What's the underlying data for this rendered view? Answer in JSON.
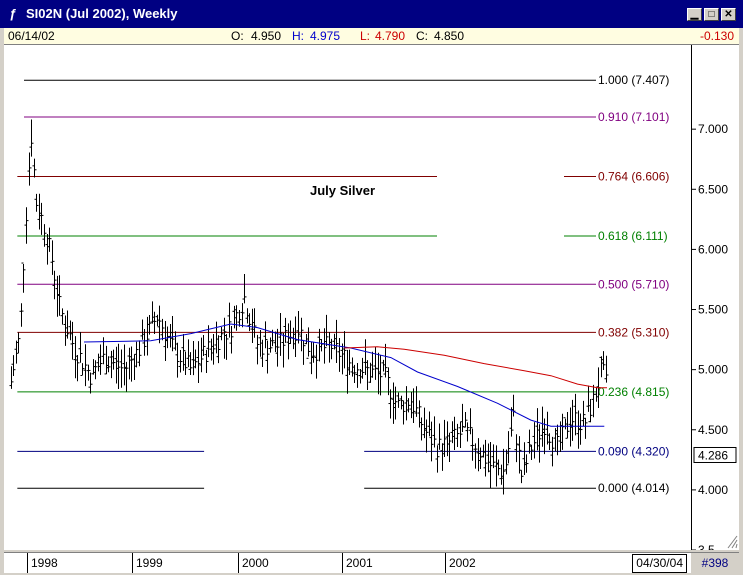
{
  "window": {
    "icon": "chart-icon",
    "title": "SI02N (Jul 2002), Weekly",
    "buttons": [
      "minimize",
      "maximize",
      "close"
    ]
  },
  "info": {
    "date": "06/14/02",
    "open_label": "O:",
    "open": "4.950",
    "high_label": "H:",
    "high": "4.975",
    "low_label": "L:",
    "low": "4.790",
    "close_label": "C:",
    "close": "4.850",
    "change": "-0.130"
  },
  "status": {
    "years": [
      "1998",
      "1999",
      "2000",
      "2001",
      "2002"
    ],
    "date_box": "04/30/04",
    "count": "#398"
  },
  "colors": {
    "background": "#ffffff",
    "price_bars": "#000000",
    "ma_short": "#0000cc",
    "ma_long": "#cc0000",
    "fib_black": "#000000",
    "fib_purple": "#800080",
    "fib_maroon": "#800000",
    "fib_green": "#008000",
    "fib_navy": "#000080"
  },
  "chart_data": {
    "type": "ohlc",
    "title": "July Silver",
    "ylim": [
      3.5,
      7.7
    ],
    "y_ticks": [
      "7.000",
      "6.500",
      "6.000",
      "5.500",
      "5.000",
      "4.500",
      "4.000",
      "3.5"
    ],
    "y_tick_values": [
      7.0,
      6.5,
      6.0,
      5.5,
      5.0,
      4.5,
      4.0,
      3.5
    ],
    "current_price_label": "4.286",
    "current_price": 4.286,
    "x_labels": [
      "1998",
      "1999",
      "2000",
      "2001",
      "2002"
    ],
    "x_range": [
      1997.9,
      2003.05
    ],
    "fib_levels": [
      {
        "ratio": "1.000",
        "price": "7.407",
        "value": 7.407,
        "color": "#000000",
        "label": "1.000 (7.407)"
      },
      {
        "ratio": "0.910",
        "price": "7.101",
        "value": 7.101,
        "color": "#800080",
        "label": "0.910 (7.101)"
      },
      {
        "ratio": "0.764",
        "price": "6.606",
        "value": 6.606,
        "color": "#800000",
        "label": "0.764 (6.606)"
      },
      {
        "ratio": "0.618",
        "price": "6.111",
        "value": 6.111,
        "color": "#008000",
        "label": "0.618 (6.111)"
      },
      {
        "ratio": "0.500",
        "price": "5.710",
        "value": 5.71,
        "color": "#800080",
        "label": "0.500 (5.710)"
      },
      {
        "ratio": "0.382",
        "price": "5.310",
        "value": 5.31,
        "color": "#800000",
        "label": "0.382 (5.310)"
      },
      {
        "ratio": "0.236",
        "price": "4.815",
        "value": 4.815,
        "color": "#008000",
        "label": "0.236 (4.815)"
      },
      {
        "ratio": "0.090",
        "price": "4.320",
        "value": 4.32,
        "color": "#000080",
        "label": "0.090 (4.320)"
      },
      {
        "ratio": "0.000",
        "price": "4.014",
        "value": 4.014,
        "color": "#000000",
        "label": "0.000 (4.014)"
      }
    ],
    "price_keypoints": [
      [
        1997.95,
        4.9
      ],
      [
        1998.02,
        5.3
      ],
      [
        1998.06,
        6.2
      ],
      [
        1998.1,
        7.0
      ],
      [
        1998.14,
        6.4
      ],
      [
        1998.2,
        6.2
      ],
      [
        1998.26,
        5.9
      ],
      [
        1998.32,
        5.5
      ],
      [
        1998.42,
        5.2
      ],
      [
        1998.55,
        4.95
      ],
      [
        1998.65,
        5.1
      ],
      [
        1998.8,
        5.0
      ],
      [
        1998.9,
        5.15
      ],
      [
        1999.05,
        5.45
      ],
      [
        1999.15,
        5.2
      ],
      [
        1999.3,
        5.0
      ],
      [
        1999.45,
        5.2
      ],
      [
        1999.6,
        5.35
      ],
      [
        1999.7,
        5.6
      ],
      [
        1999.8,
        5.2
      ],
      [
        1999.95,
        5.2
      ],
      [
        2000.1,
        5.35
      ],
      [
        2000.2,
        5.15
      ],
      [
        2000.35,
        5.2
      ],
      [
        2000.5,
        5.05
      ],
      [
        2000.6,
        5.0
      ],
      [
        2000.75,
        4.95
      ],
      [
        2000.85,
        4.7
      ],
      [
        2000.95,
        4.75
      ],
      [
        2001.05,
        4.5
      ],
      [
        2001.15,
        4.35
      ],
      [
        2001.25,
        4.4
      ],
      [
        2001.35,
        4.5
      ],
      [
        2001.45,
        4.35
      ],
      [
        2001.55,
        4.2
      ],
      [
        2001.65,
        4.15
      ],
      [
        2001.72,
        4.6
      ],
      [
        2001.78,
        4.1
      ],
      [
        2001.85,
        4.35
      ],
      [
        2001.95,
        4.55
      ],
      [
        2002.05,
        4.35
      ],
      [
        2002.15,
        4.6
      ],
      [
        2002.25,
        4.55
      ],
      [
        2002.32,
        4.75
      ],
      [
        2002.38,
        5.0
      ],
      [
        2002.42,
        4.85
      ]
    ],
    "series": [
      {
        "type": "ma",
        "color": "#0000cc",
        "points": [
          [
            1998.5,
            5.23
          ],
          [
            1999.0,
            5.24
          ],
          [
            1999.3,
            5.3
          ],
          [
            1999.6,
            5.38
          ],
          [
            1999.8,
            5.35
          ],
          [
            2000.1,
            5.25
          ],
          [
            2000.5,
            5.18
          ],
          [
            2000.8,
            5.1
          ],
          [
            2001.0,
            4.98
          ],
          [
            2001.3,
            4.86
          ],
          [
            2001.6,
            4.72
          ],
          [
            2001.85,
            4.58
          ],
          [
            2002.0,
            4.53
          ],
          [
            2002.2,
            4.53
          ],
          [
            2002.4,
            4.53
          ]
        ]
      },
      {
        "type": "ma",
        "color": "#cc0000",
        "points": [
          [
            2000.45,
            5.18
          ],
          [
            2000.7,
            5.19
          ],
          [
            2000.9,
            5.17
          ],
          [
            2001.2,
            5.12
          ],
          [
            2001.5,
            5.05
          ],
          [
            2001.8,
            4.99
          ],
          [
            2002.0,
            4.95
          ],
          [
            2002.2,
            4.88
          ],
          [
            2002.35,
            4.85
          ],
          [
            2002.42,
            4.85
          ]
        ]
      }
    ]
  }
}
